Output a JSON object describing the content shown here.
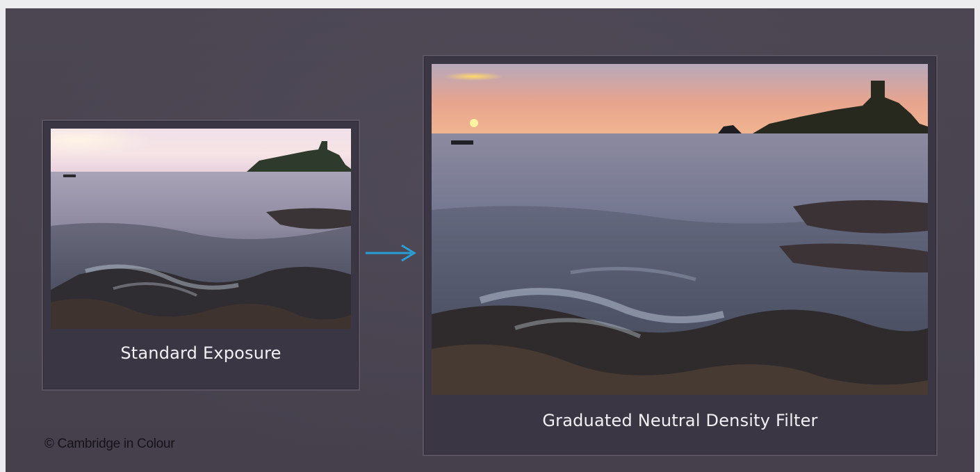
{
  "standard_caption": "Standard Exposure",
  "graduated_caption": "Graduated Neutral Density Filter",
  "credit": "© Cambridge in Colour",
  "arrow_icon": "arrow-right-icon",
  "colors": {
    "arrow": "#2a9fd6",
    "background": "#48434f",
    "card": "#3b3643"
  }
}
